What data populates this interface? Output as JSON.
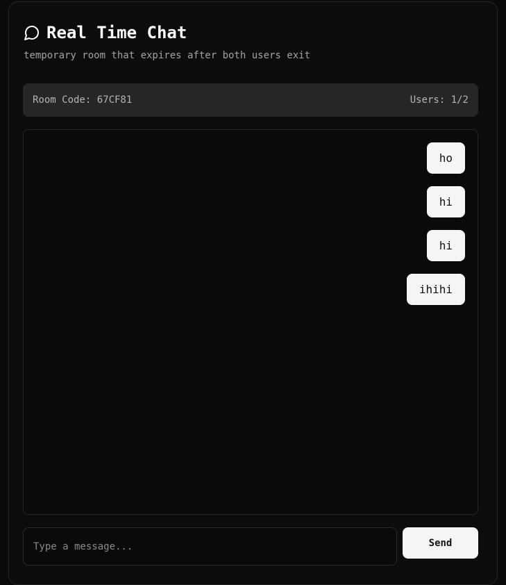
{
  "header": {
    "icon": "chat-bubble-icon",
    "title": "Real Time Chat",
    "subtitle": "temporary room that expires after both users exit"
  },
  "room": {
    "code_label": "Room Code: 67CF81",
    "users_label": "Users: 1/2"
  },
  "messages": [
    {
      "text": "ho"
    },
    {
      "text": "hi"
    },
    {
      "text": "hi"
    },
    {
      "text": "ihihi"
    }
  ],
  "composer": {
    "placeholder": "Type a message...",
    "value": "",
    "send_label": "Send"
  },
  "colors": {
    "background": "#0a0a0a",
    "card": "#0c0c0c",
    "room_bar": "#262626",
    "bubble": "#f5f5f5",
    "text_primary": "#ffffff",
    "text_muted": "#a3a3a3"
  }
}
